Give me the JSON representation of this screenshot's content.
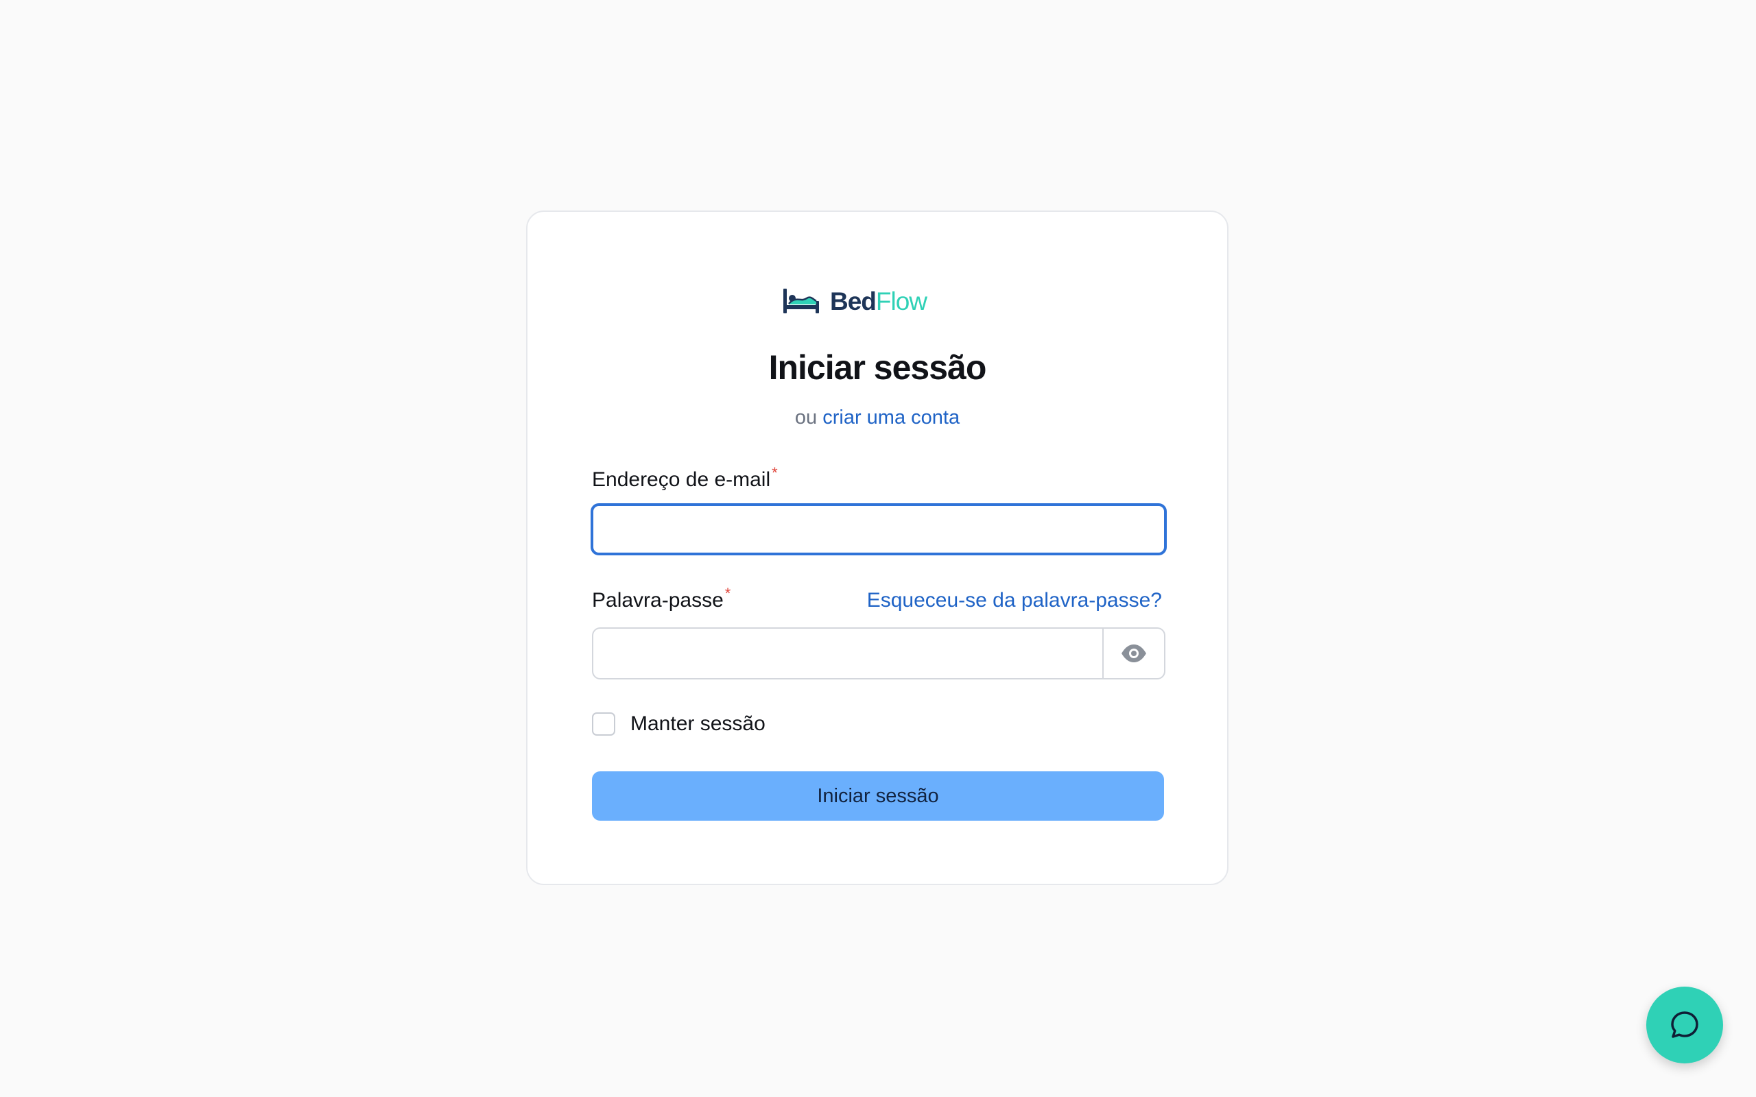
{
  "brand": {
    "name_part1": "Bed",
    "name_part2": "Flow",
    "icon": "bed-icon",
    "colors": {
      "dark": "#1e3558",
      "accent": "#2fd1b6"
    }
  },
  "login": {
    "title": "Iniciar sessão",
    "subtitle_prefix": "ou",
    "create_account_link": "criar uma conta",
    "email_label": "Endereço de e-mail",
    "email_value": "",
    "password_label": "Palavra-passe",
    "password_value": "",
    "required_marker": "*",
    "forgot_password_link": "Esqueceu-se da palavra-passe?",
    "show_password_icon": "eye-icon",
    "remember_label": "Manter sessão",
    "remember_checked": false,
    "submit_label": "Iniciar sessão"
  },
  "chat": {
    "icon": "chat-bubble-icon",
    "color": "#2fd1b6"
  },
  "colors": {
    "link": "#1f63c6",
    "focus_border": "#2f73d8",
    "button": "#6aaffd",
    "required": "#e0453b"
  }
}
